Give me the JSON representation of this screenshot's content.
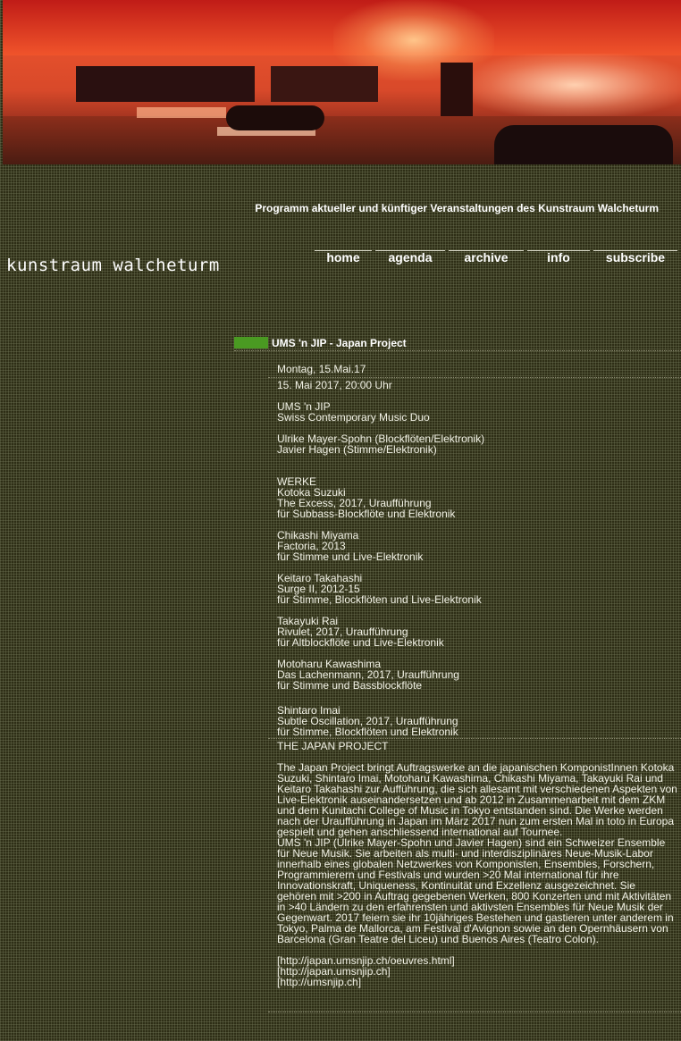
{
  "banner": {
    "image": "exhibition-room-red-light-photo"
  },
  "header": {
    "subtitle": "Programm aktueller und künftiger Veranstaltungen des Kunstraum Walcheturm",
    "logo": "kunstraum walcheturm"
  },
  "nav": {
    "items": [
      "home",
      "agenda",
      "archive",
      "info",
      "subscribe"
    ]
  },
  "event": {
    "title": "UMS 'n JIP - Japan Project",
    "date_label": "Montag, 15.Mai.17",
    "datetime": "15. Mai 2017, 20:00 Uhr",
    "intro": [
      "UMS 'n JIP",
      "Swiss Contemporary Music Duo",
      "",
      "Ulrike Mayer-Spohn (Blockflöten/Elektronik)",
      "Javier Hagen (Stimme/Elektronik)"
    ],
    "works_heading": "WERKE",
    "works": [
      [
        "Kotoka Suzuki",
        "The Excess, 2017, Uraufführung",
        "für Subbass-Blockflöte und Elektronik"
      ],
      [
        "Chikashi Miyama",
        "Factoria, 2013",
        "für Stimme und Live-Elektronik"
      ],
      [
        "Keitaro Takahashi",
        "Surge II, 2012-15",
        "für Stimme, Blockflöten und Live-Elektronik"
      ],
      [
        "Takayuki Rai",
        "Rivulet, 2017, Uraufführung",
        "für Altblockflöte und Live-Elektronik"
      ],
      [
        "Motoharu Kawashima",
        "Das Lachenmann, 2017, Uraufführung",
        "für Stimme und Bassblockflöte"
      ],
      [
        "Shintaro Imai",
        "Subtle Oscillation, 2017, Uraufführung",
        "für Stimme, Blockflöten und Elektronik"
      ]
    ],
    "project_heading": "THE JAPAN PROJECT",
    "project_text_1": "The Japan Project bringt Auftragswerke an die japanischen KomponistInnen Kotoka Suzuki, Shintaro Imai, Motoharu Kawashima, Chikashi Miyama, Takayuki Rai und Keitaro Takahashi zur Aufführung, die sich allesamt mit verschiedenen Aspekten von Live-Elektronik auseinandersetzen und ab 2012 in Zusammenarbeit mit dem ZKM und dem Kunitachi College of Music in Tokyo entstanden sind. Die Werke werden nach der Uraufführung in Japan im März 2017 nun zum ersten Mal in toto in Europa gespielt und gehen anschliessend international auf Tournee.",
    "project_text_2": "UMS 'n JIP (Ulrike Mayer-Spohn und Javier Hagen) sind ein Schweizer Ensemble für Neue Musik. Sie arbeiten als multi- und interdisziplinäres Neue-Musik-Labor innerhalb eines globalen Netzwerkes von Komponisten, Ensembles, Forschern, Programmierern und Festivals und wurden >20 Mal international für ihre Innovationskraft, Uniqueness, Kontinuität und Exzellenz ausgezeichnet. Sie gehören mit >200 in Auftrag gegebenen Werken, 800 Konzerten und mit Aktivitäten in >40 Ländern zu den erfahrensten und aktivsten Ensembles für Neue Musik der Gegenwart. 2017 feiern sie ihr 10jähriges Bestehen und gastieren unter anderem in Tokyo, Palma de Mallorca, am Festival d'Avignon sowie an den Opernhäusern von Barcelona (Gran Teatre del Liceu) und Buenos Aires (Teatro Colon).",
    "links": [
      "[http://japan.umsnjip.ch/oeuvres.html]",
      "[http://japan.umsnjip.ch]",
      "[http://umsnjip.ch]"
    ]
  },
  "colors": {
    "background": "#2e2e16",
    "accent": "#4a9a22",
    "text": "#f2f2e6"
  }
}
